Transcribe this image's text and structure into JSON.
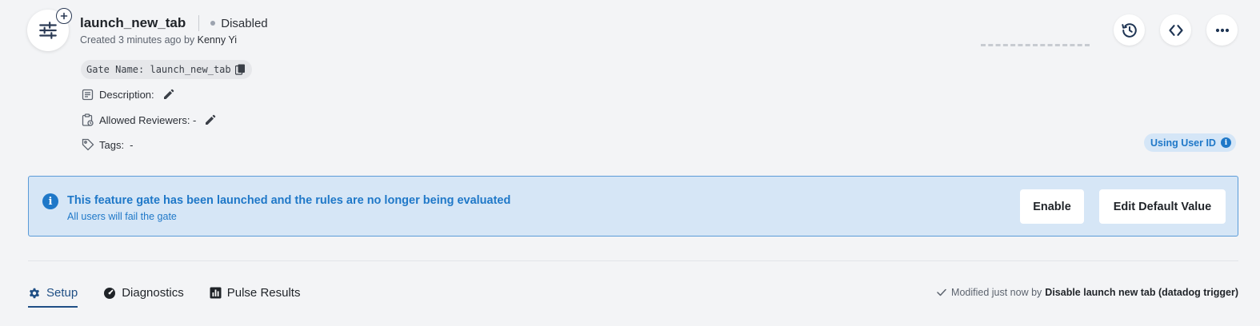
{
  "header": {
    "title": "launch_new_tab",
    "status": "Disabled",
    "created_prefix": "Created 3 minutes ago by",
    "created_by": "Kenny Yi",
    "gate_name_label": "Gate Name: launch_new_tab"
  },
  "meta": {
    "description_label": "Description:",
    "reviewers_label": "Allowed Reviewers: -",
    "tags_label": "Tags:",
    "tags_value": "-"
  },
  "id_type": {
    "label": "Using User ID"
  },
  "banner": {
    "headline": "This feature gate has been launched and the rules are no longer being evaluated",
    "subline": "All users will fail the gate",
    "enable_label": "Enable",
    "edit_default_label": "Edit Default Value"
  },
  "tabs": [
    {
      "label": "Setup",
      "icon": "gear-icon",
      "active": true
    },
    {
      "label": "Diagnostics",
      "icon": "gauge-icon",
      "active": false
    },
    {
      "label": "Pulse Results",
      "icon": "bar-chart-icon",
      "active": false
    }
  ],
  "modified": {
    "prefix": "Modified just now by",
    "trigger": "Disable launch new tab (datadog trigger)"
  },
  "colors": {
    "accent": "#1f78c8",
    "banner_bg": "#d6e6f6",
    "active_tab": "#1f4f85"
  },
  "icons": {
    "gate": "sliders-icon",
    "history": "history-icon",
    "code": "code-icon",
    "more": "more-horizontal-icon"
  }
}
